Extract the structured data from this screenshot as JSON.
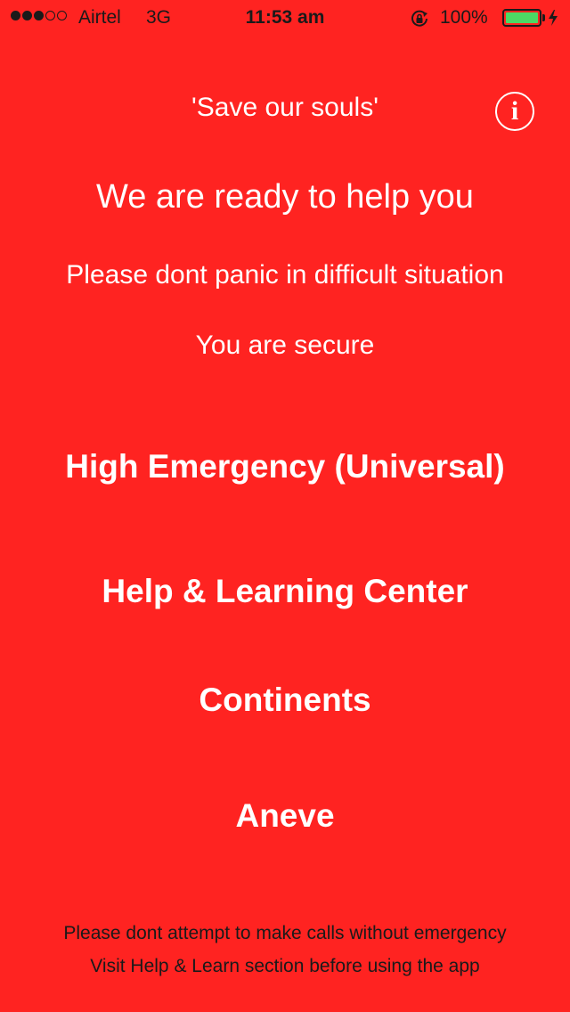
{
  "status_bar": {
    "carrier": "Airtel",
    "network": "3G",
    "time": "11:53 am",
    "battery_percent": "100%",
    "battery_level": 1.0,
    "signal_bars_filled": 3,
    "signal_bars_total": 5,
    "icons": [
      "orientation-lock-icon",
      "battery-icon",
      "charging-icon"
    ],
    "battery_color": "#4cd964"
  },
  "header": {
    "title": "'Save our souls'",
    "info_icon": "i"
  },
  "intro": {
    "headline": "We are ready to help you",
    "line1": "Please dont panic in difficult situation",
    "line2": "You are secure"
  },
  "menu": {
    "high_emergency": "High Emergency (Universal)",
    "help_learning": "Help & Learning Center",
    "continents": "Continents",
    "aneve": "Aneve"
  },
  "footer": {
    "line1": "Please dont attempt to make calls without emergency",
    "line2": "Visit Help & Learn section before using the app"
  },
  "colors": {
    "background": "#ff2321",
    "primary_text": "#ffffff",
    "footer_text": "#1a1a1a"
  }
}
